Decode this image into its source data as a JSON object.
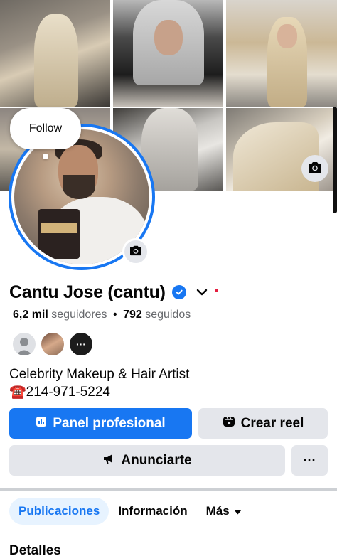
{
  "cover": {
    "tiles": [
      "cover-photo-1",
      "cover-photo-2",
      "cover-photo-3",
      "cover-photo-4",
      "cover-photo-5",
      "cover-photo-6"
    ],
    "camera_icon": "camera-icon"
  },
  "avatar": {
    "follow_bubble": "Follow",
    "camera_icon": "camera-icon",
    "bag_text": "CANTU COFFEE"
  },
  "profile": {
    "name": "Cantu Jose (cantu)",
    "verified_icon": "verified-badge-icon",
    "followers_count": "6,2 mil",
    "followers_label": "seguidores",
    "separator": "•",
    "following_count": "792",
    "following_label": "seguidos",
    "more_friends": "···",
    "bio_line1": "Celebrity Makeup & Hair Artist",
    "bio_line2": "☎️214-971-5224"
  },
  "actions": {
    "panel": "Panel profesional",
    "reel": "Crear reel",
    "ads": "Anunciarte",
    "more": "···"
  },
  "tabs": [
    {
      "label": "Publicaciones",
      "active": true
    },
    {
      "label": "Información",
      "active": false
    },
    {
      "label": "Más",
      "active": false
    }
  ],
  "section": {
    "title": "Detalles"
  },
  "colors": {
    "accent": "#1877f2",
    "button_gray": "#e4e6eb",
    "tab_active_bg": "#e7f3ff",
    "notification_dot": "#e41e3f"
  }
}
